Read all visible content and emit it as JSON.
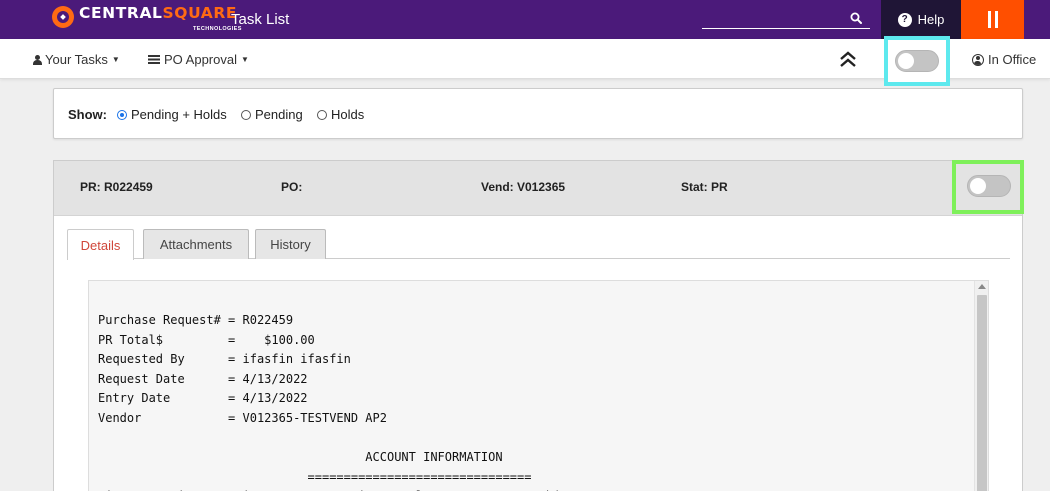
{
  "topbar": {
    "brand_central": "CENTRAL",
    "brand_square": "SQUARE",
    "brand_tech": "TECHNOLOGIES",
    "app_title": "Task List",
    "search": {
      "value": "",
      "placeholder": ""
    },
    "help_label": "Help",
    "colors": {
      "bar": "#4b1a7a",
      "accent": "#ff4f00",
      "help_bg": "#1f1536"
    }
  },
  "nav": {
    "your_tasks": "Your Tasks",
    "po_approval": "PO Approval",
    "in_office": "In Office",
    "toggle_on": false
  },
  "show": {
    "label": "Show:",
    "options": [
      {
        "label": "Pending + Holds",
        "checked": true
      },
      {
        "label": "Pending",
        "checked": false
      },
      {
        "label": "Holds",
        "checked": false
      }
    ]
  },
  "task": {
    "pr": "PR: R022459",
    "po": "PO:",
    "vend": "Vend: V012365",
    "stat": "Stat: PR",
    "toggle_on": false,
    "tabs": [
      {
        "label": "Details",
        "active": true
      },
      {
        "label": "Attachments",
        "active": false
      },
      {
        "label": "History",
        "active": false
      }
    ],
    "detail_lines": [
      "Purchase Request# = R022459",
      "PR Total$         =    $100.00",
      "Requested By      = ifasfin ifasfin",
      "Request Date      = 4/13/2022",
      "Entry Date        = 4/13/2022",
      "Vendor            = V012365-TESTVEND AP2",
      "",
      "                                     ACCOUNT INFORMATION",
      "                             ===============================",
      "Line# Quantity    Price            Line Total   Account      Object   Act/Bu"
    ]
  },
  "highlights": {
    "cyan": "#5de9ee",
    "green": "#7ef05a"
  }
}
